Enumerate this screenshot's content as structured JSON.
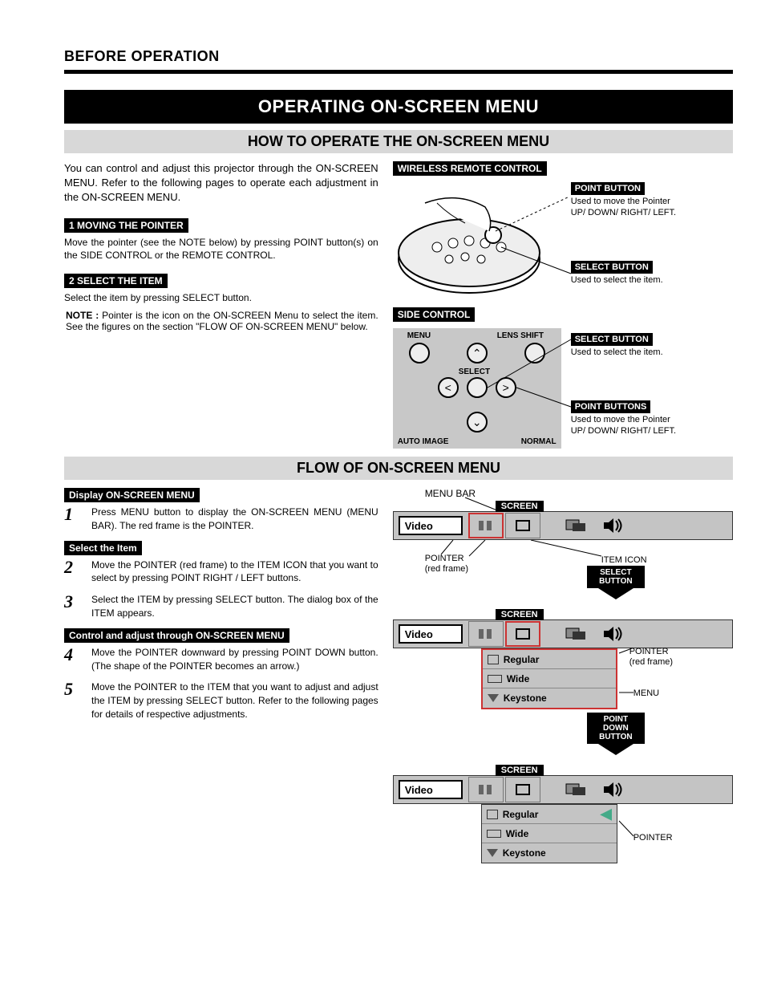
{
  "header": "BEFORE OPERATION",
  "title_banner": "OPERATING ON-SCREEN MENU",
  "section1": {
    "subbanner": "HOW TO OPERATE THE ON-SCREEN MENU",
    "intro": "You can control and adjust this projector through the ON-SCREEN MENU. Refer to the following pages to operate each adjustment in the ON-SCREEN MENU.",
    "step1_label": "1  MOVING THE POINTER",
    "step1_body": "Move the pointer (see the NOTE below) by pressing POINT button(s) on the SIDE CONTROL or the REMOTE CONTROL.",
    "step2_label": "2  SELECT THE ITEM",
    "step2_body": "Select the item by pressing SELECT button.",
    "note_prefix": "NOTE :",
    "note_body": "Pointer is the icon on the ON-SCREEN Menu to select the item. See the figures on the section \"FLOW OF ON-SCREEN MENU\" below.",
    "remote": {
      "title": "WIRELESS REMOTE CONTROL",
      "point_btn_label": "POINT BUTTON",
      "point_btn_desc": "Used to move the Pointer UP/ DOWN/ RIGHT/ LEFT.",
      "select_btn_label": "SELECT BUTTON",
      "select_btn_desc": "Used to select the item."
    },
    "side_control": {
      "title": "SIDE CONTROL",
      "labels": {
        "menu": "MENU",
        "lens_shift": "LENS SHIFT",
        "select": "SELECT",
        "auto_image": "AUTO IMAGE",
        "normal": "NORMAL"
      },
      "select_btn_label": "SELECT BUTTON",
      "select_btn_desc": "Used to select the item.",
      "point_btns_label": "POINT BUTTONS",
      "point_btns_desc": "Used to move the Pointer UP/ DOWN/ RIGHT/ LEFT."
    }
  },
  "section2": {
    "subbanner": "FLOW OF ON-SCREEN MENU",
    "group1_label": "Display ON-SCREEN MENU",
    "step1": "Press MENU button to display the ON-SCREEN MENU (MENU BAR). The red frame is the POINTER.",
    "group2_label": "Select the Item",
    "step2": "Move the POINTER (red frame) to the ITEM ICON that you want to select by pressing POINT RIGHT / LEFT buttons.",
    "step3": "Select the ITEM by pressing SELECT button. The dialog box of the ITEM appears.",
    "group3_label": "Control and adjust through ON-SCREEN MENU",
    "step4": "Move the POINTER downward by pressing POINT DOWN button. (The shape of the POINTER becomes an arrow.)",
    "step5": "Move the POINTER to the ITEM that you want to adjust and adjust the ITEM by pressing SELECT button. Refer to the following pages for details of respective adjustments.",
    "flow": {
      "menu_bar_label": "MENU BAR",
      "screen_label": "SCREEN",
      "mode": "Video",
      "pointer_note": "POINTER",
      "pointer_note_sub": "(red frame)",
      "item_icon_note": "ITEM ICON",
      "select_button": "SELECT BUTTON",
      "dropdown": {
        "regular": "Regular",
        "wide": "Wide",
        "keystone": "Keystone"
      },
      "pointer_red_note": "POINTER",
      "pointer_red_sub": "(red frame)",
      "menu_note": "MENU",
      "point_down_button": "POINT DOWN BUTTON",
      "pointer_final": "POINTER"
    }
  }
}
